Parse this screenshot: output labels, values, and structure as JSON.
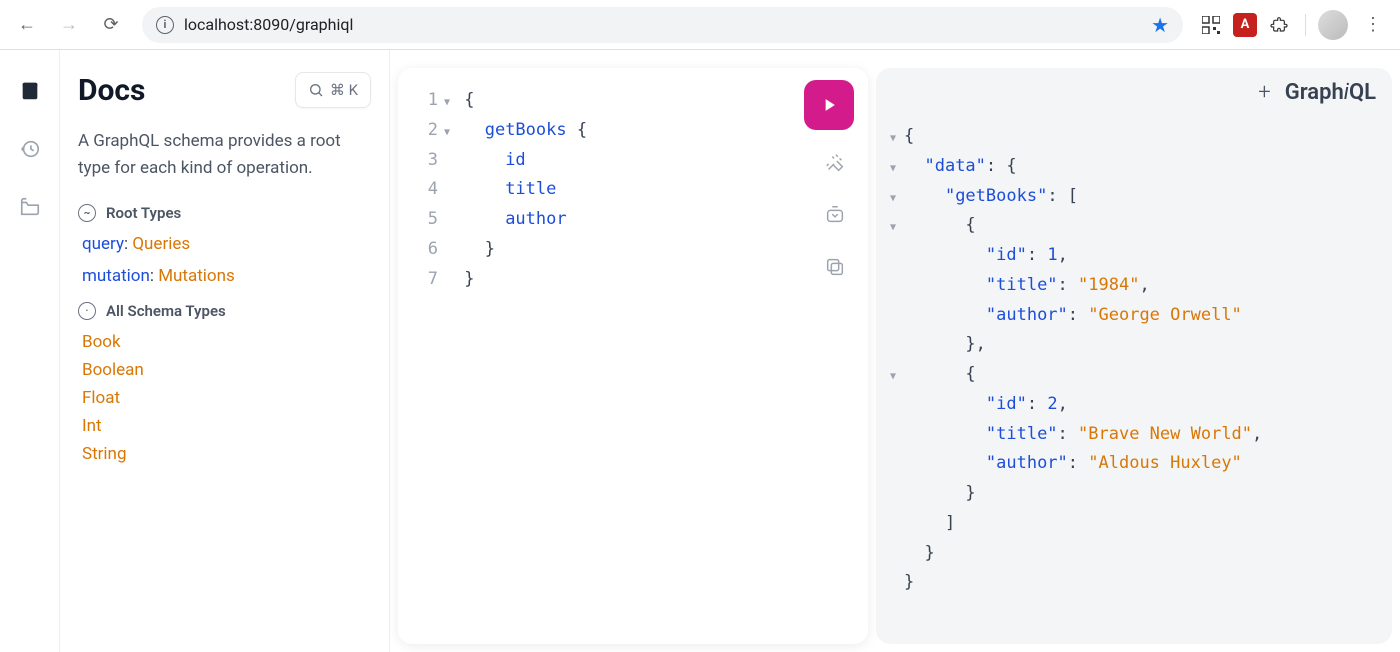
{
  "browser": {
    "url": "localhost:8090/graphiql",
    "extensions": {
      "pdf_label": "A"
    }
  },
  "rail": {},
  "docs": {
    "title": "Docs",
    "search_shortcut": "⌘ K",
    "description": "A GraphQL schema provides a root type for each kind of operation.",
    "root_types_label": "Root Types",
    "root_types": [
      {
        "field": "query",
        "type": "Queries"
      },
      {
        "field": "mutation",
        "type": "Mutations"
      }
    ],
    "all_schema_label": "All Schema Types",
    "schema_types": [
      "Book",
      "Boolean",
      "Float",
      "Int",
      "String"
    ]
  },
  "query": {
    "lines": [
      {
        "n": 1,
        "fold": "▼",
        "tokens": [
          {
            "t": "{",
            "c": "punct"
          }
        ]
      },
      {
        "n": 2,
        "fold": "▼",
        "indent": 1,
        "tokens": [
          {
            "t": "getBooks",
            "c": "ident"
          },
          {
            "t": " {",
            "c": "punct"
          }
        ]
      },
      {
        "n": 3,
        "indent": 2,
        "tokens": [
          {
            "t": "id",
            "c": "ident"
          }
        ]
      },
      {
        "n": 4,
        "indent": 2,
        "tokens": [
          {
            "t": "title",
            "c": "ident"
          }
        ]
      },
      {
        "n": 5,
        "indent": 2,
        "tokens": [
          {
            "t": "author",
            "c": "ident"
          }
        ]
      },
      {
        "n": 6,
        "indent": 1,
        "tokens": [
          {
            "t": "}",
            "c": "punct"
          }
        ]
      },
      {
        "n": 7,
        "tokens": [
          {
            "t": "}",
            "c": "punct"
          }
        ]
      }
    ]
  },
  "result": {
    "lines": [
      {
        "fold": "▼",
        "indent": 0,
        "tokens": [
          {
            "t": "{",
            "c": "punct"
          }
        ]
      },
      {
        "fold": "▼",
        "indent": 1,
        "tokens": [
          {
            "t": "\"data\"",
            "c": "key"
          },
          {
            "t": ": ",
            "c": "colon"
          },
          {
            "t": "{",
            "c": "punct"
          }
        ]
      },
      {
        "fold": "▼",
        "indent": 2,
        "tokens": [
          {
            "t": "\"getBooks\"",
            "c": "key"
          },
          {
            "t": ": ",
            "c": "colon"
          },
          {
            "t": "[",
            "c": "punct"
          }
        ]
      },
      {
        "fold": "▼",
        "indent": 3,
        "tokens": [
          {
            "t": "{",
            "c": "punct"
          }
        ]
      },
      {
        "indent": 4,
        "tokens": [
          {
            "t": "\"id\"",
            "c": "key"
          },
          {
            "t": ": ",
            "c": "colon"
          },
          {
            "t": "1",
            "c": "num"
          },
          {
            "t": ",",
            "c": "punct"
          }
        ]
      },
      {
        "indent": 4,
        "tokens": [
          {
            "t": "\"title\"",
            "c": "key"
          },
          {
            "t": ": ",
            "c": "colon"
          },
          {
            "t": "\"1984\"",
            "c": "str"
          },
          {
            "t": ",",
            "c": "punct"
          }
        ]
      },
      {
        "indent": 4,
        "tokens": [
          {
            "t": "\"author\"",
            "c": "key"
          },
          {
            "t": ": ",
            "c": "colon"
          },
          {
            "t": "\"George Orwell\"",
            "c": "str"
          }
        ]
      },
      {
        "indent": 3,
        "tokens": [
          {
            "t": "},",
            "c": "punct"
          }
        ]
      },
      {
        "fold": "▼",
        "indent": 3,
        "tokens": [
          {
            "t": "{",
            "c": "punct"
          }
        ]
      },
      {
        "indent": 4,
        "tokens": [
          {
            "t": "\"id\"",
            "c": "key"
          },
          {
            "t": ": ",
            "c": "colon"
          },
          {
            "t": "2",
            "c": "num"
          },
          {
            "t": ",",
            "c": "punct"
          }
        ]
      },
      {
        "indent": 4,
        "tokens": [
          {
            "t": "\"title\"",
            "c": "key"
          },
          {
            "t": ": ",
            "c": "colon"
          },
          {
            "t": "\"Brave New World\"",
            "c": "str"
          },
          {
            "t": ",",
            "c": "punct"
          }
        ]
      },
      {
        "indent": 4,
        "tokens": [
          {
            "t": "\"author\"",
            "c": "key"
          },
          {
            "t": ": ",
            "c": "colon"
          },
          {
            "t": "\"Aldous Huxley\"",
            "c": "str"
          }
        ]
      },
      {
        "indent": 3,
        "tokens": [
          {
            "t": "}",
            "c": "punct"
          }
        ]
      },
      {
        "indent": 2,
        "tokens": [
          {
            "t": "]",
            "c": "punct"
          }
        ]
      },
      {
        "indent": 1,
        "tokens": [
          {
            "t": "}",
            "c": "punct"
          }
        ]
      },
      {
        "indent": 0,
        "tokens": [
          {
            "t": "}",
            "c": "punct"
          }
        ]
      }
    ]
  },
  "tabs": {
    "logo_a": "Graph",
    "logo_b": "i",
    "logo_c": "QL",
    "plus": "+"
  }
}
